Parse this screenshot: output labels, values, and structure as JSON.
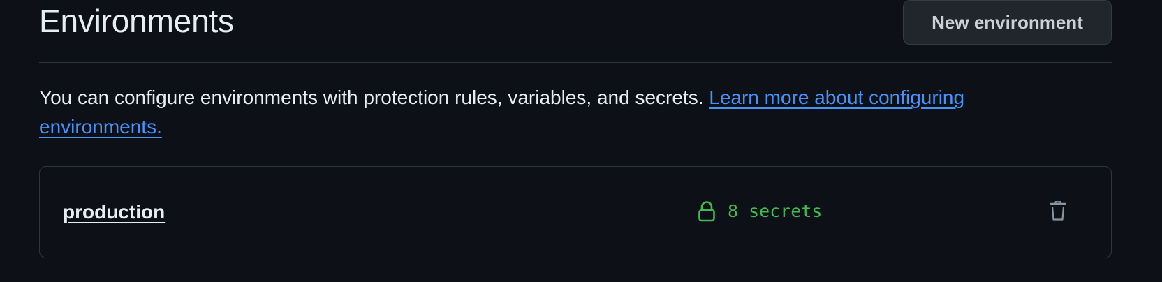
{
  "header": {
    "title": "Environments",
    "new_button_label": "New environment"
  },
  "description": {
    "text": "You can configure environments with protection rules, variables, and secrets. ",
    "link_text": "Learn more about configuring environments."
  },
  "environments": [
    {
      "name": "production",
      "secrets_label": "8 secrets",
      "secrets_icon": "lock-icon",
      "delete_icon": "trash-icon"
    }
  ],
  "colors": {
    "background": "#0d1117",
    "border": "#30363d",
    "text": "#e6edf3",
    "link": "#4493f8",
    "success": "#3fb950",
    "button_bg": "#21262d",
    "icon_muted": "#8b949e"
  }
}
